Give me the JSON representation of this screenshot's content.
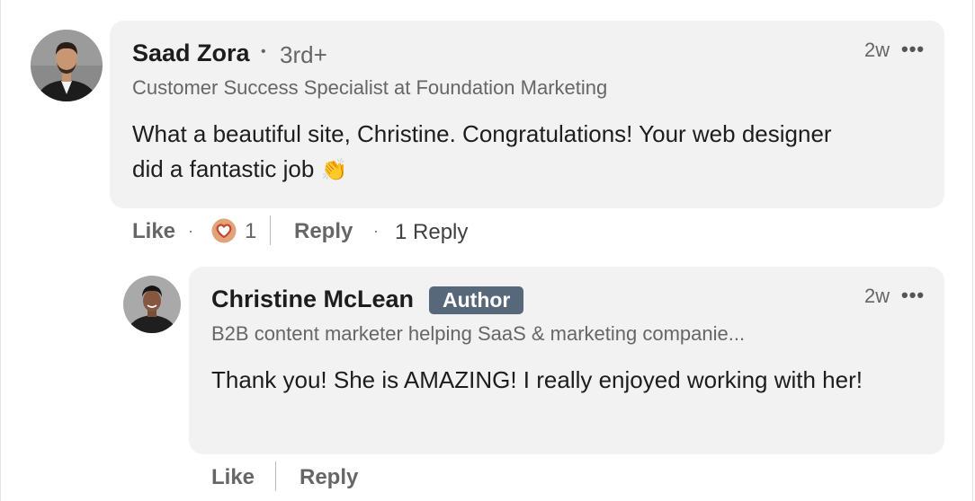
{
  "comment": {
    "author": "Saad Zora",
    "degree": "3rd+",
    "separator_dot": "•",
    "headline": "Customer Success Specialist at Foundation Marketing",
    "text": "What a beautiful site, Christine. Congratulations! Your web designer did a fantastic job",
    "emoji": "👏",
    "time": "2w",
    "more": "•••",
    "actions": {
      "like": "Like",
      "reaction_count": "1",
      "reply": "Reply",
      "replies_link": "1 Reply"
    }
  },
  "reply": {
    "author": "Christine McLean",
    "badge": "Author",
    "headline": "B2B content marketer helping SaaS & marketing companie...",
    "text": "Thank you! She is AMAZING! I really enjoyed working with her!",
    "time": "2w",
    "more": "•••",
    "actions": {
      "like": "Like",
      "reply": "Reply"
    }
  },
  "icons": [
    "avatar-saad",
    "avatar-christine",
    "heart-reaction-icon",
    "more-icon"
  ],
  "colors": {
    "bubble": "#f2f2f2",
    "badge": "#56687a",
    "heart_ring": "#e2a37b",
    "heart_fill": "#c6482a"
  }
}
